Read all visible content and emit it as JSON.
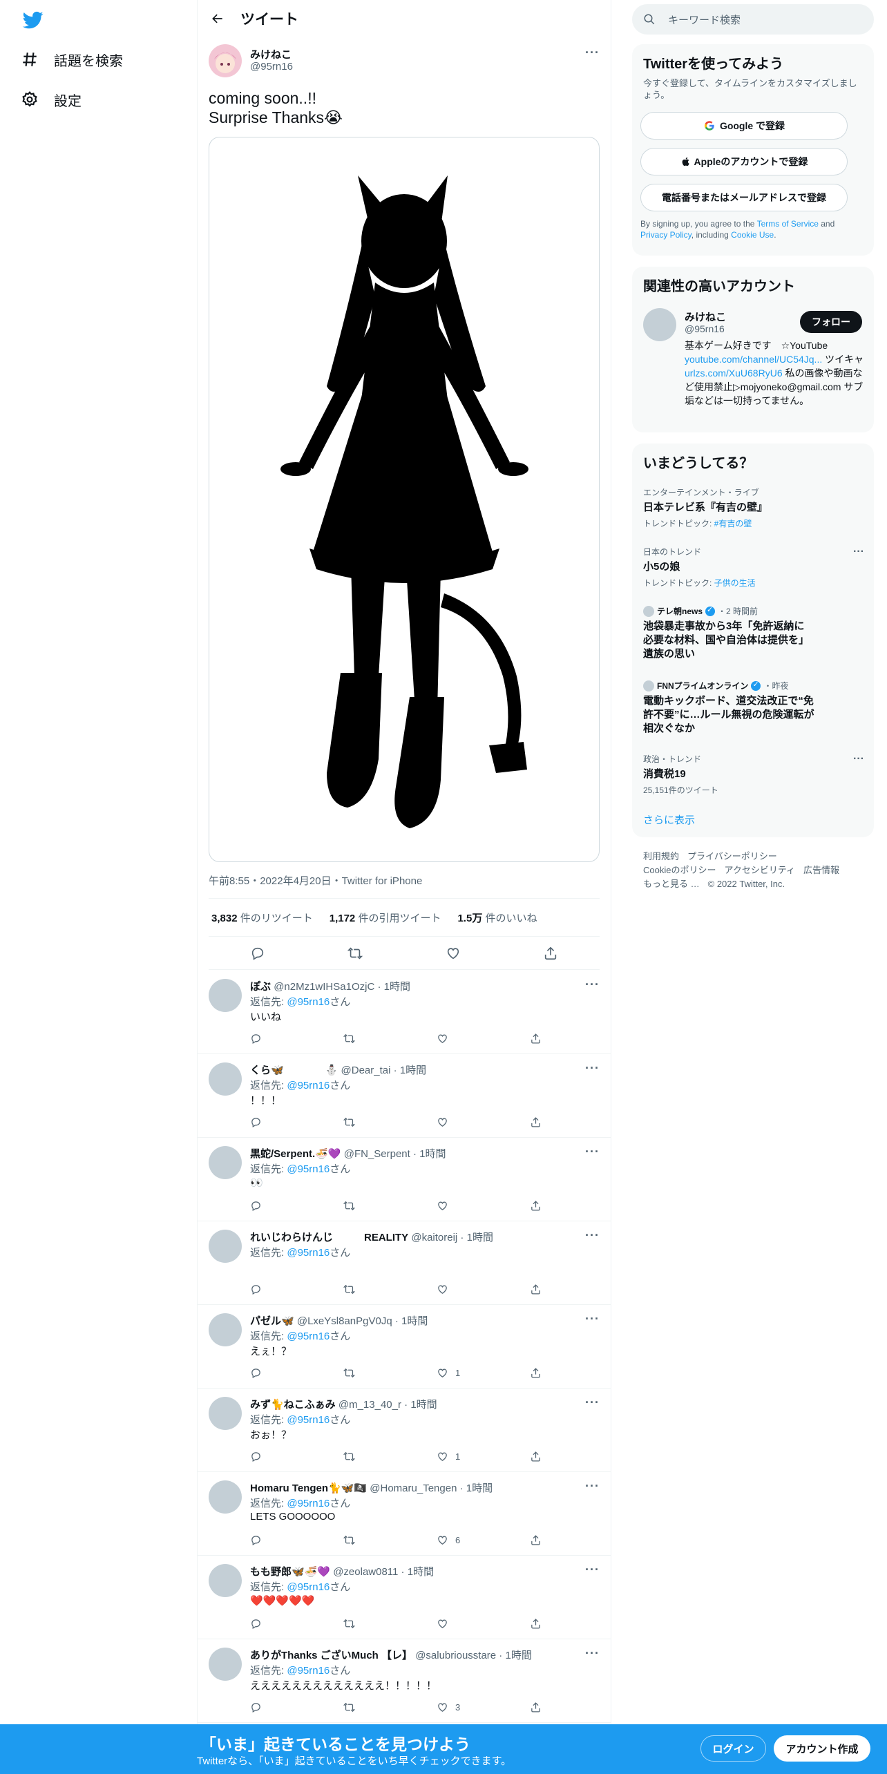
{
  "nav": {
    "logo": "twitter-bird",
    "items": [
      {
        "label": "話題を検索",
        "icon": "hash-icon"
      },
      {
        "label": "設定",
        "icon": "gear-icon"
      }
    ]
  },
  "header": {
    "title": "ツイート"
  },
  "tweet": {
    "author_name": "みけねこ",
    "author_handle": "@95rn16",
    "text_line1": "coming soon..!!",
    "text_line2": "Surprise Thanks😭",
    "meta": "午前8:55・2022年4月20日・Twitter for iPhone",
    "stats": [
      {
        "count": "3,832",
        "label": "件のリツイート"
      },
      {
        "count": "1,172",
        "label": "件の引用ツイート"
      },
      {
        "count": "1.5万",
        "label": "件のいいね"
      }
    ]
  },
  "replies": [
    {
      "name": "ぽぶ",
      "handle": "@n2Mz1wIHSa1OzjC",
      "time": "1時間",
      "reply_prefix": "返信先: ",
      "reply_to": "@95rn16",
      "reply_suffix": "さん",
      "text": "いいね",
      "likes": ""
    },
    {
      "name": "くら🦋　　　　⛄",
      "handle": "@Dear_tai",
      "time": "1時間",
      "reply_prefix": "返信先: ",
      "reply_to": "@95rn16",
      "reply_suffix": "さん",
      "text": "！！！",
      "likes": ""
    },
    {
      "name": "黒蛇/Serpent.🍜💜",
      "handle": "@FN_Serpent",
      "time": "1時間",
      "reply_prefix": "返信先: ",
      "reply_to": "@95rn16",
      "reply_suffix": "さん",
      "text": "👀",
      "likes": ""
    },
    {
      "name": "れいじわらけんじ　　　REALITY",
      "handle": "@kaitoreij",
      "time": "1時間",
      "reply_prefix": "返信先: ",
      "reply_to": "@95rn16",
      "reply_suffix": "さん",
      "text": "",
      "likes": ""
    },
    {
      "name": "パゼル🦋",
      "handle": "@LxeYsl8anPgV0Jq",
      "time": "1時間",
      "reply_prefix": "返信先: ",
      "reply_to": "@95rn16",
      "reply_suffix": "さん",
      "text": "えぇ！？",
      "likes": "1"
    },
    {
      "name": "みず🐈ねこふぁみ",
      "handle": "@m_13_40_r",
      "time": "1時間",
      "reply_prefix": "返信先: ",
      "reply_to": "@95rn16",
      "reply_suffix": "さん",
      "text": "おぉ！？",
      "likes": "1"
    },
    {
      "name": "Homaru Tengen🐈🦋🏴‍☠️",
      "handle": "@Homaru_Tengen",
      "time": "1時間",
      "reply_prefix": "返信先: ",
      "reply_to": "@95rn16",
      "reply_suffix": "さん",
      "text": "LETS GOOOOOO",
      "likes": "6"
    },
    {
      "name": "もも野郎🦋🍜💜",
      "handle": "@zeolaw0811",
      "time": "1時間",
      "reply_prefix": "返信先: ",
      "reply_to": "@95rn16",
      "reply_suffix": "さん",
      "text": "❤️❤️❤️❤️❤️",
      "likes": ""
    },
    {
      "name": "ありがThanks ございMuch 【レ】",
      "handle": "@salubriousstare",
      "time": "1時間",
      "reply_prefix": "返信先: ",
      "reply_to": "@95rn16",
      "reply_suffix": "さん",
      "text": "えええええええええええええ！！！！！",
      "likes": "3"
    }
  ],
  "search": {
    "placeholder": "キーワード検索"
  },
  "signup": {
    "title": "Twitterを使ってみよう",
    "subtitle": "今すぐ登録して、タイムラインをカスタマイズしましょう。",
    "google": "Google で登録",
    "apple": "Appleのアカウントで登録",
    "phone": "電話番号またはメールアドレスで登録",
    "legal_1": "By signing up, you agree to the ",
    "legal_terms": "Terms of Service",
    "legal_2": " and ",
    "legal_privacy": "Privacy Policy",
    "legal_3": ", including ",
    "legal_cookie": "Cookie Use",
    "legal_4": "."
  },
  "related": {
    "title": "関連性の高いアカウント",
    "name": "みけねこ",
    "handle": "@95rn16",
    "follow": "フォロー",
    "bio_1": "基本ゲーム好きです　☆YouTube ",
    "bio_link1": "youtube.com/channel/UC54Jq...",
    "bio_2": " ツイキャ",
    "bio_link2": "urlzs.com/XuU68RyU6",
    "bio_3": " 私の画像や動画など使用禁止▷mojyoneko@gmail.com サブ垢などは一切持ってません。"
  },
  "trends": {
    "title": "いまどうしてる？",
    "items": [
      {
        "category": "エンターテインメント・ライブ",
        "topic": "日本テレビ系『有吉の壁』",
        "extra_prefix": "トレンドトピック: ",
        "extra_link": "#有吉の壁"
      },
      {
        "category": "日本のトレンド",
        "topic": "小5の娘",
        "extra_prefix": "トレンドトピック: ",
        "extra_link": "子供の生活"
      },
      {
        "source": "テレ朝news",
        "time": "・2 時間前",
        "topic": "池袋暴走事故から3年「免許返納に必要な材料、国や自治体は提供を」　遺族の思い"
      },
      {
        "source": "FNNプライムオンライン",
        "time": "・昨夜",
        "topic": "電動キックボード、道交法改正で“免許不要”に…ルール無視の危険運転が相次ぐなか"
      },
      {
        "category": "政治・トレンド",
        "topic": "消費税19",
        "extra_prefix": "25,151件のツイート",
        "extra_link": ""
      }
    ],
    "more": "さらに表示"
  },
  "footer": {
    "links": [
      "利用規約",
      "プライバシーポリシー",
      "Cookieのポリシー",
      "アクセシビリティ",
      "広告情報",
      "もっと見る …",
      "© 2022 Twitter, Inc."
    ]
  },
  "bottombar": {
    "title": "「いま」起きていることを見つけよう",
    "subtitle": "Twitterなら、「いま」起きていることをいち早くチェックできます。",
    "login": "ログイン",
    "signup": "アカウント作成"
  },
  "colors": {
    "accent": "#1d9bf0",
    "text": "#0f1419",
    "muted": "#536471"
  }
}
